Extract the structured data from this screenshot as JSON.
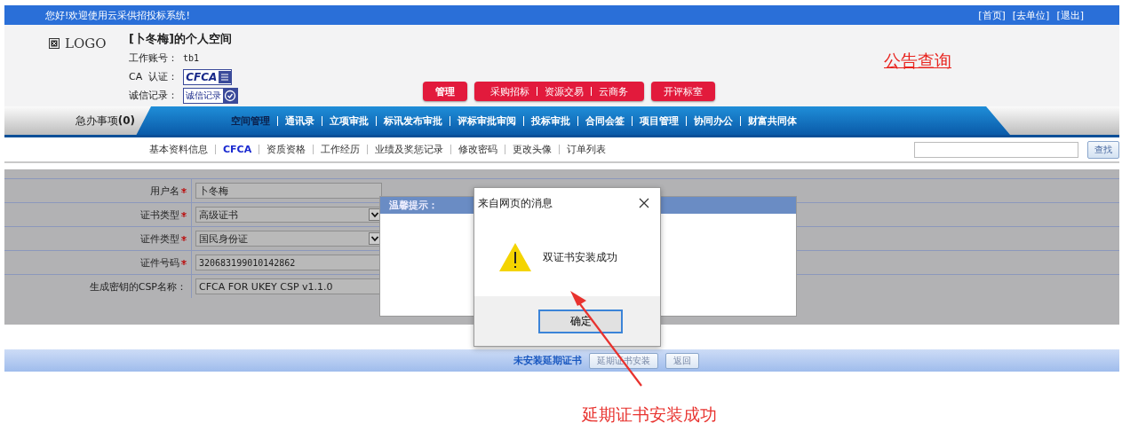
{
  "top_bar": {
    "greeting": "您好!欢迎使用云采供招投标系统!",
    "links": [
      "[首页]",
      "[去单位]",
      "[退出]"
    ]
  },
  "header": {
    "logo_label": "LOGO",
    "space_title": "[卜冬梅]的个人空间",
    "account_label": "工作账号：",
    "account_value": "tb1",
    "ca_label": "CA  认证：",
    "ca_badge": "CFCA",
    "credit_label": "诚信记录：",
    "credit_badge": "诚信记录",
    "buttons": [
      {
        "kind": "single",
        "labels": [
          "管理"
        ]
      },
      {
        "kind": "group",
        "labels": [
          "采购招标",
          "资源交易",
          "云商务"
        ]
      },
      {
        "kind": "single",
        "labels": [
          "开评标室"
        ]
      }
    ],
    "notice_link": "公告查询"
  },
  "nav": {
    "pending_label": "急办事项",
    "pending_count": "(0)",
    "items": [
      {
        "label": "空间管理",
        "selected": true
      },
      {
        "label": "通讯录",
        "selected": false
      },
      {
        "label": "立项审批",
        "selected": false
      },
      {
        "label": "标讯发布审批",
        "selected": false
      },
      {
        "label": "评标审批审阅",
        "selected": false
      },
      {
        "label": "投标审批",
        "selected": false
      },
      {
        "label": "合同会签",
        "selected": false
      },
      {
        "label": "项目管理",
        "selected": false
      },
      {
        "label": "协同办公",
        "selected": false
      },
      {
        "label": "财富共同体",
        "selected": false
      }
    ]
  },
  "subnav": {
    "items": [
      {
        "label": "基本资料信息",
        "selected": false
      },
      {
        "label": "CFCA",
        "selected": true
      },
      {
        "label": "资质资格",
        "selected": false
      },
      {
        "label": "工作经历",
        "selected": false
      },
      {
        "label": "业绩及奖惩记录",
        "selected": false
      },
      {
        "label": "修改密码",
        "selected": false
      },
      {
        "label": "更改头像",
        "selected": false
      },
      {
        "label": "订单列表",
        "selected": false
      }
    ],
    "search_button": "查找"
  },
  "form": {
    "rows": [
      {
        "label": "用户名",
        "required": true,
        "kind": "text",
        "value": "卜冬梅"
      },
      {
        "label": "证书类型",
        "required": true,
        "kind": "select",
        "value": "高级证书"
      },
      {
        "label": "证件类型",
        "required": true,
        "kind": "select",
        "value": "国民身份证"
      },
      {
        "label": "证件号码",
        "required": true,
        "kind": "text",
        "value": "320683199010142862"
      },
      {
        "label": "生成密钥的CSP名称：",
        "required": false,
        "kind": "text",
        "value": "CFCA FOR UKEY CSP v1.1.0"
      }
    ]
  },
  "tip_dialog": {
    "title": "温馨提示："
  },
  "message_box": {
    "title": "来自网页的消息",
    "text": "双证书安装成功",
    "ok_button": "确定"
  },
  "footer_bar": {
    "status": "未安装延期证书",
    "buttons": [
      "延期证书安装",
      "返回"
    ]
  },
  "annotation": {
    "text": "延期证书安装成功"
  }
}
